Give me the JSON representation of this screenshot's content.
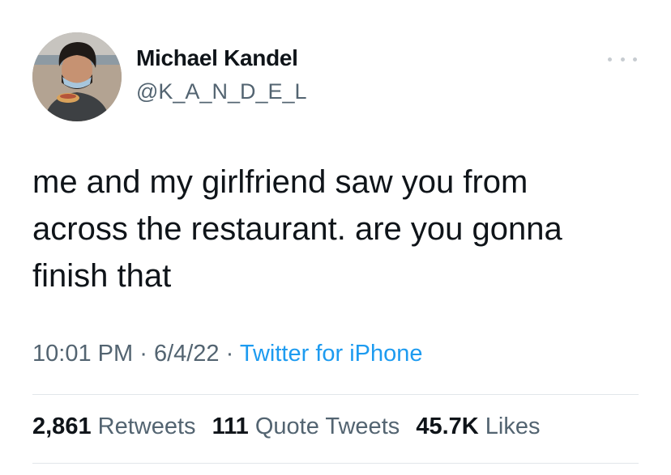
{
  "author": {
    "name": "Michael Kandel",
    "handle": "@K_A_N_D_E_L"
  },
  "tweet": {
    "lines": [
      "me and my girlfriend saw you from",
      "across the restaurant. are you gonna",
      "finish that"
    ]
  },
  "meta": {
    "time": "10:01 PM",
    "separator": "·",
    "date": "6/4/22",
    "source": "Twitter for iPhone"
  },
  "stats": {
    "retweets": {
      "count": "2,861",
      "label": "Retweets"
    },
    "quotes": {
      "count": "111",
      "label": "Quote Tweets"
    },
    "likes": {
      "count": "45.7K",
      "label": "Likes"
    }
  },
  "icons": {
    "more": "more-horizontal-icon"
  },
  "colors": {
    "text": "#0f1419",
    "secondary": "#536471",
    "link": "#1d9bf0",
    "divider": "#e1e6ea"
  }
}
